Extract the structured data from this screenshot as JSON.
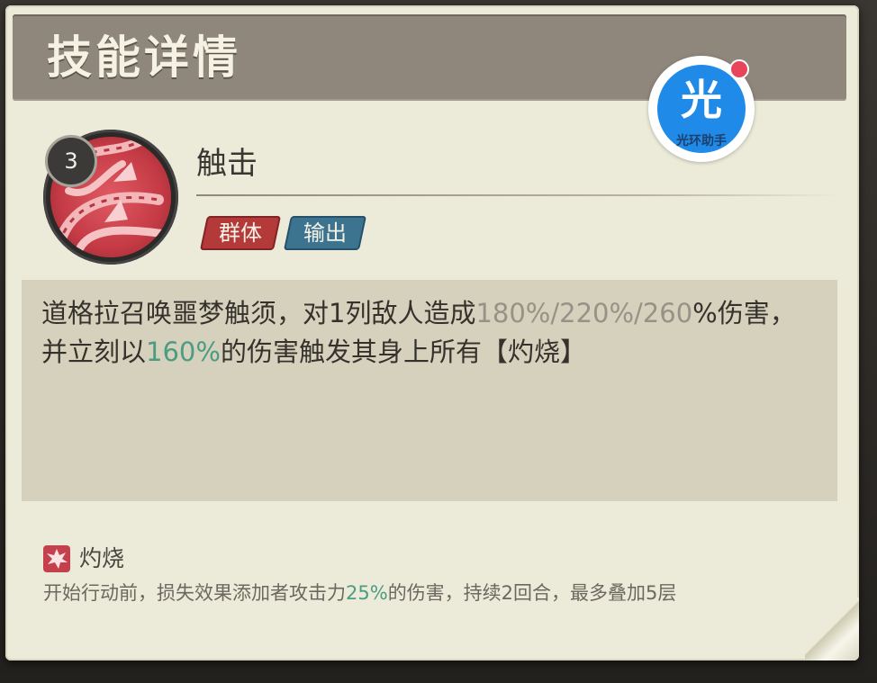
{
  "header": {
    "title": "技能详情"
  },
  "watermark": {
    "glyph": "光",
    "caption": "光环助手"
  },
  "skill": {
    "level": "3",
    "name": "触击",
    "tags": [
      {
        "label": "群体",
        "color": "#b43a3a"
      },
      {
        "label": "输出",
        "color": "#3c7490"
      }
    ],
    "description": {
      "part1": "道格拉召唤噩梦触须，对1列敌人造成",
      "values_gray": "180%/220%/260",
      "part2": "%伤害，并立刻以",
      "value_green": "160%",
      "part3": "的伤害触发其身上所有【灼烧】"
    }
  },
  "status_effect": {
    "icon": "burn-icon",
    "name": "灼烧",
    "desc_part1": "开始行动前，损失效果添加者攻击力",
    "desc_value": "25%",
    "desc_part2": "的伤害，持续2回合，最多叠加5层"
  },
  "colors": {
    "card_bg": "#ecebd9",
    "header_bg": "#8f877c",
    "highlight_gray": "#979287",
    "highlight_green": "#4c9b83",
    "watermark_blue": "#1f8ae8"
  }
}
